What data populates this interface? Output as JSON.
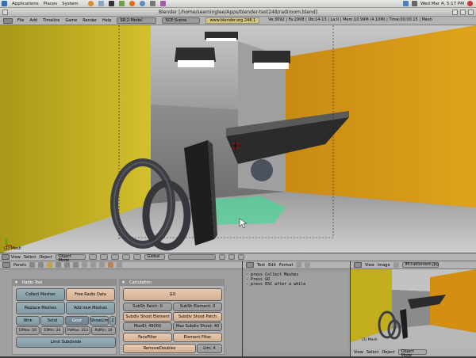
{
  "system_bar": {
    "menus": [
      "Applications",
      "Places",
      "System"
    ],
    "datetime": "Wed Mar 4,  5:17 PM"
  },
  "window": {
    "title": "Blender [/home/seeminglee/Apps/blender-test248/radiroom.blend]"
  },
  "blender_header": {
    "menus": [
      "File",
      "Add",
      "Timeline",
      "Game",
      "Render",
      "Help"
    ],
    "screen": "SR:2-Model",
    "scene": "SCE:Scene",
    "url": "www.blender.org 248.1",
    "stats": "Ve:3092 | Fa:2908 | Ob:14-13 | La:0 | Mem:10.99M (4.10M) | Time:00:00.15 | Mesh"
  },
  "viewport": {
    "object_label": "(1) Mesh"
  },
  "view3d_header": {
    "menus": [
      "View",
      "Select",
      "Object"
    ],
    "mode": "Object Mode",
    "orientation": "Global"
  },
  "buttons_window": {
    "header_menu": "Panels",
    "radio_tool": {
      "title": "Radio Tool",
      "collect": "Collect Meshes",
      "free": "Free Radio Data",
      "replace": "Replace Meshes",
      "add_new": "Add new Meshes",
      "draw_wire": "Wire",
      "draw_solid": "Solid",
      "draw_gour": "Gour",
      "show_lim": "ShowLim",
      "show_z": "Z",
      "elmax": "ElMax: 50",
      "elmin": "ElMin: 20",
      "pamax": "PaMax: 313",
      "pamin": "PaMin: 10",
      "limit_subdivide": "Limit Subdivide"
    },
    "calculation": {
      "title": "Calculation",
      "go": "GO",
      "subsh_patch": "SubSh Patch: 0",
      "subsh_element": "SubSh Element: 0",
      "subdiv_shoot_element": "Subdiv Shoot Element",
      "subdiv_shoot_patch": "Subdiv Shoot Patch",
      "maxel": "MaxEl: 49000",
      "max_subdiv_shoot": "Max Subdiv Shoot: 40",
      "face_filter": "FaceFilter",
      "element_filter": "Element Filter",
      "remove_doubles": "RemoveDoubles",
      "lim": "Lim: 4"
    }
  },
  "text_editor": {
    "menus": [
      "Text",
      "Edit",
      "Format"
    ],
    "lines": [
      "- press Collect Meshes",
      "- Press GO",
      "- press ESC after a while"
    ]
  },
  "image_window": {
    "menus": [
      "View",
      "Image"
    ],
    "image_name": "IM:radioroom.jpg",
    "footer_menus": [
      "View",
      "Select",
      "Object"
    ],
    "footer_mode": "Object Mode",
    "object_label": "(1) Mesh"
  },
  "colors": {
    "yellow_wall": "#c9b11c",
    "orange_wall": "#d08a0c",
    "floor_green": "#4fd39a",
    "ui_gray": "#b4b4b4"
  }
}
